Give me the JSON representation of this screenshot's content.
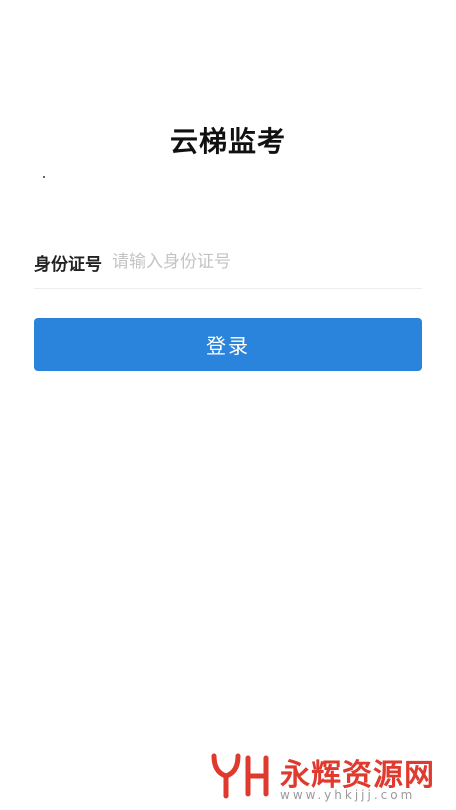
{
  "app": {
    "title": "云梯监考"
  },
  "form": {
    "id_label": "身份证号",
    "id_placeholder": "请输入身份证号",
    "id_value": ""
  },
  "actions": {
    "login_label": "登录"
  },
  "colors": {
    "primary": "#2b84dc",
    "watermark_red": "#e0392e"
  },
  "watermark": {
    "logo_text": "YH",
    "name": "永辉资源网",
    "url": "www.yhkjjj.com"
  }
}
